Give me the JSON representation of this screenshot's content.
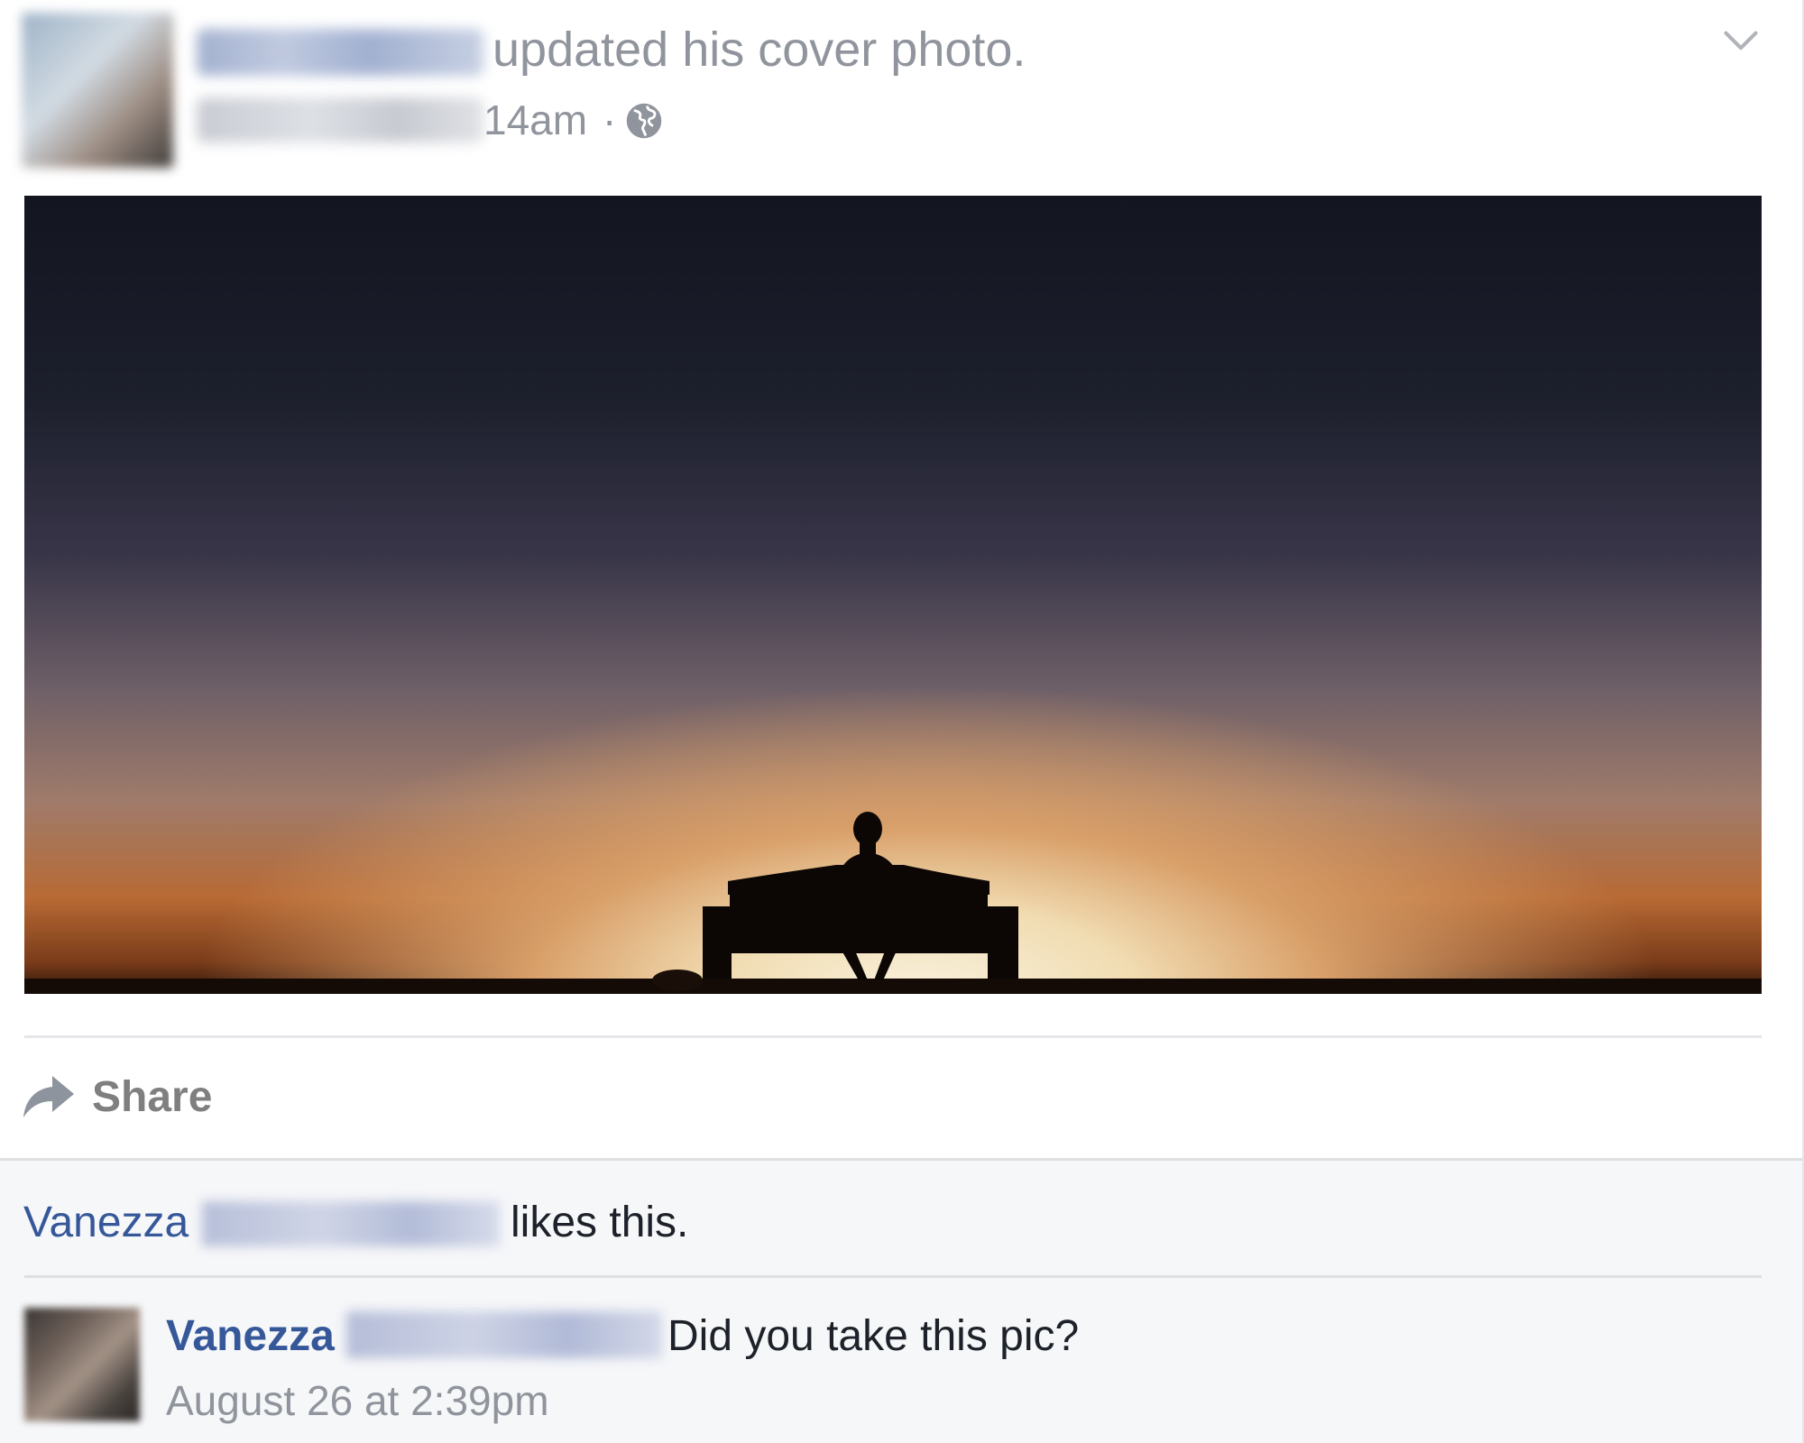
{
  "post": {
    "action_text": "updated his cover photo.",
    "time_fragment": "14am",
    "separator": "·",
    "privacy_icon": "globe-icon",
    "menu_icon": "chevron-down-icon"
  },
  "actions": {
    "share_label": "Share",
    "share_icon": "share-arrow-icon"
  },
  "likes": {
    "first_name": "Vanezza",
    "suffix": "likes this."
  },
  "comment": {
    "author_first_name": "Vanezza",
    "text": "Did you take this pic?",
    "timestamp": "August 26 at 2:39pm"
  },
  "colors": {
    "link": "#365899",
    "meta": "#90949c",
    "body_text": "#1d2129",
    "ufi_bg": "#f6f7f9",
    "divider": "#e5e6e9"
  }
}
